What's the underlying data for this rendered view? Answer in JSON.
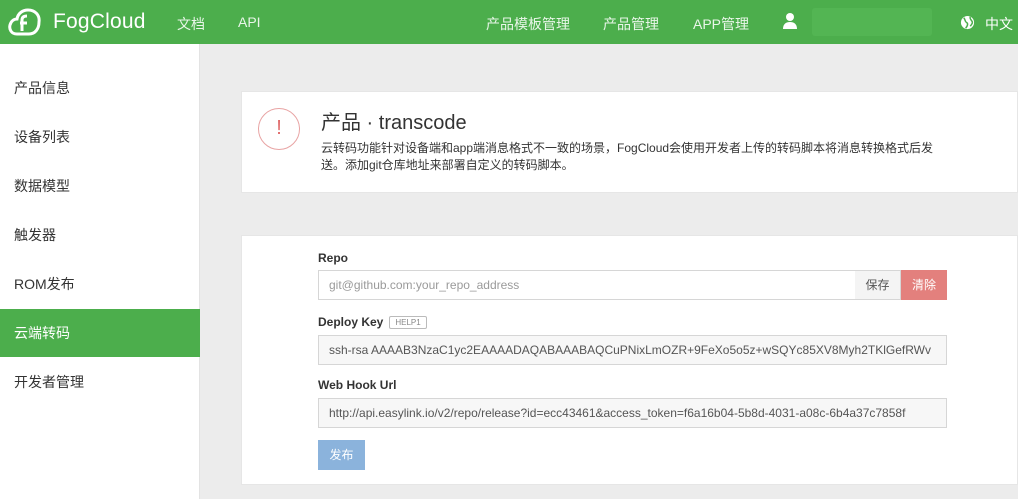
{
  "header": {
    "brand": "FogCloud",
    "nav_left": [
      "文档",
      "API"
    ],
    "nav_right": [
      "产品模板管理",
      "产品管理",
      "APP管理"
    ],
    "language": "中文",
    "icons": [
      "fogcloud-logo-icon",
      "user-icon",
      "globe-icon"
    ]
  },
  "sidebar": {
    "items": [
      {
        "label": "产品信息",
        "active": false
      },
      {
        "label": "设备列表",
        "active": false
      },
      {
        "label": "数据模型",
        "active": false
      },
      {
        "label": "触发器",
        "active": false
      },
      {
        "label": "ROM发布",
        "active": false
      },
      {
        "label": "云端转码",
        "active": true
      },
      {
        "label": "开发者管理",
        "active": false
      }
    ]
  },
  "product": {
    "alert_icon": "!",
    "title": "产品 · transcode",
    "description": "云转码功能针对设备端和app端消息格式不一致的场景，FogCloud会使用开发者上传的转码脚本将消息转换格式后发送。添加git仓库地址来部署自定义的转码脚本。"
  },
  "form": {
    "repo_label": "Repo",
    "repo_placeholder": "git@github.com:your_repo_address",
    "save_label": "保存",
    "clear_label": "清除",
    "deploy_key_label": "Deploy Key",
    "deploy_key_badge": "HELP1",
    "deploy_key_value": "ssh-rsa AAAAB3NzaC1yc2EAAAADAQABAAABAQCuPNixLmOZR+9FeXo5o5z+wSQYc85XV8Myh2TKlGefRWv",
    "webhook_label": "Web Hook Url",
    "webhook_value": "http://api.easylink.io/v2/repo/release?id=ecc43461&access_token=f6a16b04-5b8d-4031-a08c-6b4a37c7858f",
    "publish_label": "发布"
  },
  "colors": {
    "brand_green": "#4cae4c",
    "danger": "#e3807d",
    "primary_disabled": "#8bb3dc"
  }
}
